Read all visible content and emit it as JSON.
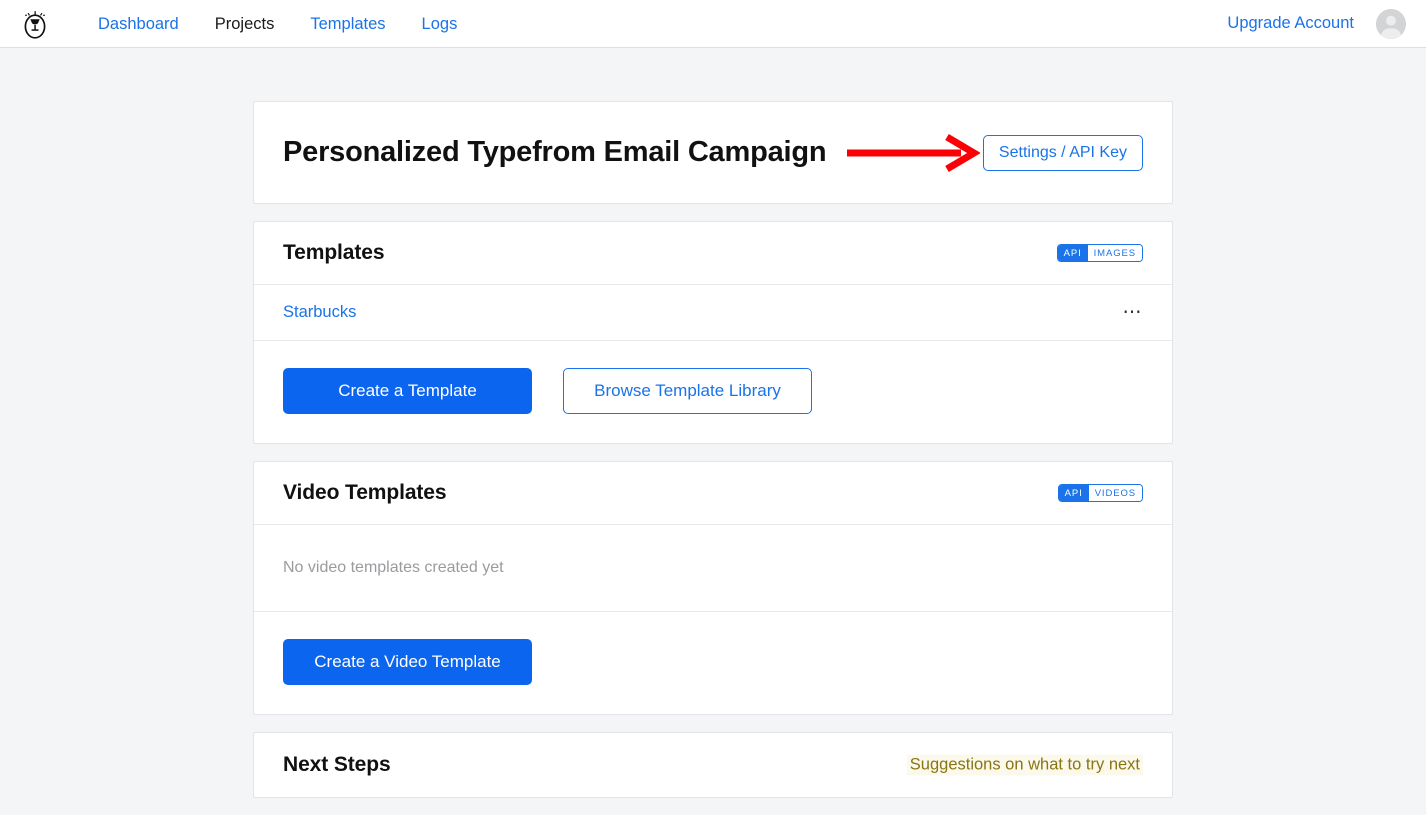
{
  "topbar": {
    "logo_icon": "egg-trophy-logo-icon",
    "nav": [
      {
        "label": "Dashboard",
        "current": false
      },
      {
        "label": "Projects",
        "current": true
      },
      {
        "label": "Templates",
        "current": false
      },
      {
        "label": "Logs",
        "current": false
      }
    ],
    "upgrade_label": "Upgrade Account",
    "avatar_icon": "user-avatar-icon"
  },
  "project": {
    "title": "Personalized Typefrom Email Campaign",
    "settings_button": "Settings / API Key",
    "annotation_arrow_color": "#fb0007"
  },
  "templates": {
    "title": "Templates",
    "badge_left": "API",
    "badge_right": "IMAGES",
    "items": [
      {
        "name": "Starbucks",
        "menu_icon": "more-options-icon"
      }
    ],
    "create_button": "Create a Template",
    "browse_button": "Browse Template Library"
  },
  "video_templates": {
    "title": "Video Templates",
    "badge_left": "API",
    "badge_right": "VIDEOS",
    "empty_text": "No video templates created yet",
    "create_button": "Create a Video Template"
  },
  "next_steps": {
    "title": "Next Steps",
    "suggestion": "Suggestions on what to try next"
  },
  "colors": {
    "link_blue": "#1a73e8",
    "primary_blue": "#0b65ef",
    "page_bg": "#f4f5f7",
    "card_bg": "#ffffff",
    "suggestion_text": "#8a7512",
    "suggestion_bg": "#fbf9ec",
    "arrow_red": "#fb0007"
  }
}
